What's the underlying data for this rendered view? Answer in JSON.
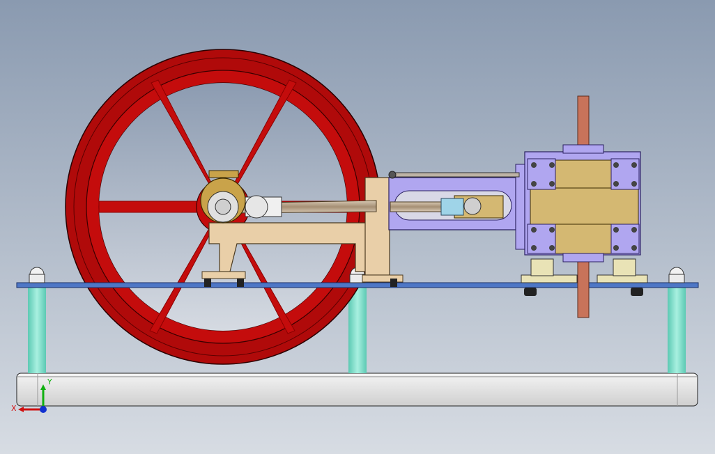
{
  "viewport": {
    "background_top": "#8a9ab0",
    "background_bottom": "#d7dce3"
  },
  "model": {
    "flywheel_color": "#c40c0c",
    "frame_color": "#e9cfa8",
    "cylinder_color": "#b0a6f0",
    "valve_chest_color": "#d4b872",
    "steam_pipe_color": "#c8735a",
    "deck_color": "#4e77c6",
    "post_color": "#7fe0cc",
    "base_color": "#e1e1e1"
  },
  "triad": {
    "x_label": "X",
    "y_label": "Y",
    "x_color": "#d01010",
    "y_color": "#10b010",
    "z_color": "#1030d0"
  }
}
